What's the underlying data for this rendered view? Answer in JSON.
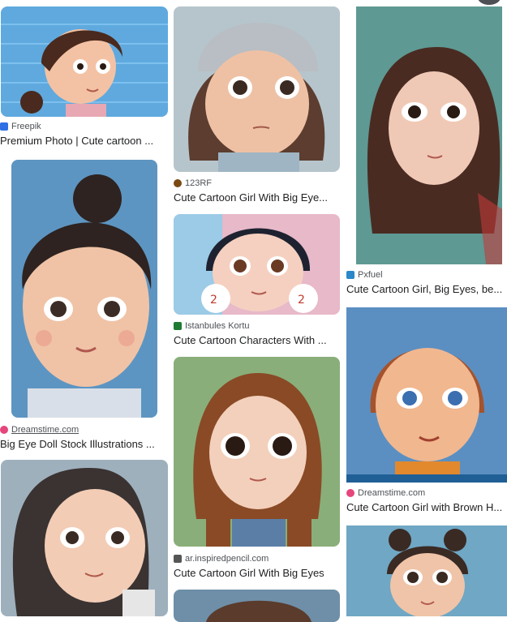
{
  "results": [
    {
      "source": "Freepik",
      "title": "Premium Photo | Cute cartoon ...",
      "source_color": "#2f6fe4"
    },
    {
      "source": "Dreamstime.com",
      "title": "Big Eye Doll Stock Illustrations ...",
      "source_color": "#e5467c"
    },
    {
      "source": "123RF",
      "title": "Cute Cartoon Girl With Big Eye...",
      "source_color": "#7a4a12"
    },
    {
      "source": "Istanbules Kortu",
      "title": "Cute Cartoon Characters With ...",
      "source_color": "#1e7b34"
    },
    {
      "source": "ar.inspiredpencil.com",
      "title": "Cute Cartoon Girl With Big Eyes",
      "source_color": "#555555"
    },
    {
      "source": "Pxfuel",
      "title": "Cute Cartoon Girl, Big Eyes, be...",
      "source_color": "#2a88c9"
    },
    {
      "source": "Dreamstime.com",
      "title": "Cute Cartoon Girl with Brown H...",
      "source_color": "#e5467c"
    }
  ],
  "icons": {
    "image_thumbnails": "cartoon-girl-portrait",
    "source_favicons": "site-favicon",
    "corner_control": "menu-dot-icon"
  }
}
